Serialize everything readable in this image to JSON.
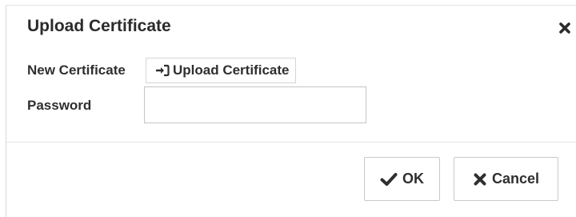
{
  "dialog": {
    "title": "Upload Certificate",
    "close_icon": "close-icon"
  },
  "form": {
    "new_certificate_label": "New Certificate",
    "upload_button_label": "Upload Certificate",
    "upload_icon": "sign-in-icon",
    "password_label": "Password",
    "password_value": ""
  },
  "footer": {
    "ok_label": "OK",
    "ok_icon": "check-icon",
    "cancel_label": "Cancel",
    "cancel_icon": "x-icon"
  }
}
